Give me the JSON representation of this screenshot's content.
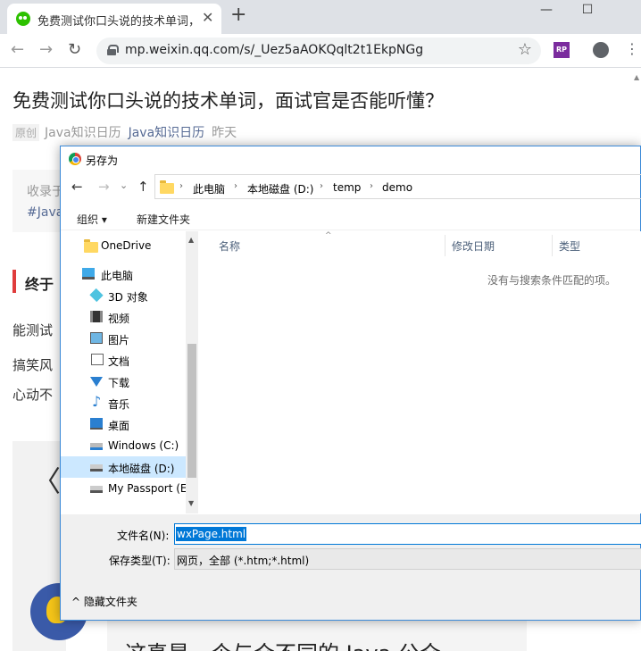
{
  "browser": {
    "tab_title": "免费测试你口头说的技术单词，面试官是否能听懂？",
    "tab_close": "✕",
    "new_tab": "+",
    "win_minimize": "—",
    "win_maximize": "☐",
    "url": "mp.weixin.qq.com/s/_Uez5aAOKQqlt2t1EkpNGg",
    "ext_label": "RP",
    "back": "←",
    "forward": "→",
    "reload": "↻",
    "star": "☆",
    "menu": "⋮"
  },
  "article": {
    "title": "免费测试你口头说的技术单词，面试官是否能听懂？",
    "original_tag": "原创",
    "account_plain": "Java知识日历",
    "account_link": "Java知识日历",
    "date": "昨天",
    "collect_prefix": "收录于",
    "collect_tag": "#Java",
    "section_title": "终于",
    "para1": "能测试",
    "para2": "搞笑风",
    "para3": "心动不",
    "carousel_prev": "〈",
    "bottom_text": "这真是一个与众不同的 Java 公众"
  },
  "dialog": {
    "title": "另存为",
    "nav_back": "←",
    "nav_forward": "→",
    "nav_dropdown": "⌄",
    "nav_up": "↑",
    "breadcrumb": [
      "此电脑",
      "本地磁盘 (D:)",
      "temp",
      "demo"
    ],
    "crumb_sep": "›",
    "organize_label": "组织 ▾",
    "new_folder_label": "新建文件夹",
    "nav_items": [
      {
        "label": "OneDrive"
      },
      {
        "label": "此电脑"
      },
      {
        "label": "3D 对象"
      },
      {
        "label": "视频"
      },
      {
        "label": "图片"
      },
      {
        "label": "文档"
      },
      {
        "label": "下载"
      },
      {
        "label": "音乐"
      },
      {
        "label": "桌面"
      },
      {
        "label": "Windows (C:)"
      },
      {
        "label": "本地磁盘 (D:)"
      },
      {
        "label": "My Passport (E"
      }
    ],
    "music_glyph": "♪",
    "columns": {
      "name": "名称",
      "modified": "修改日期",
      "type": "类型"
    },
    "sort_caret": "^",
    "empty_message": "没有与搜索条件匹配的项。",
    "filename_label": "文件名(N):",
    "filename_value": "wxPage.html",
    "filetype_label": "保存类型(T):",
    "filetype_value": "网页，全部 (*.htm;*.html)",
    "hide_folders_label": "^  隐藏文件夹",
    "scroll_up": "▲",
    "scroll_down": "▼"
  }
}
